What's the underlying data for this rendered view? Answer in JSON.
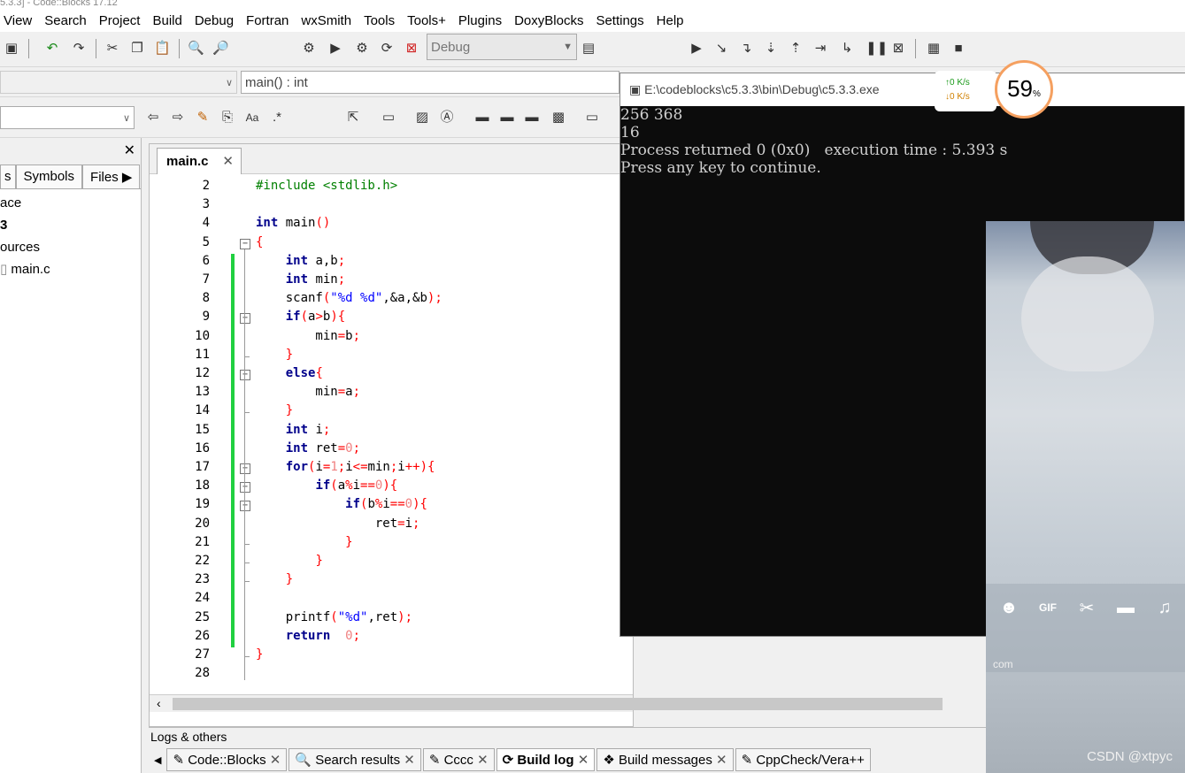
{
  "window": {
    "title_fragment": "5.3.3] - Code::Blocks 17.12"
  },
  "menu": [
    "View",
    "Search",
    "Project",
    "Build",
    "Debug",
    "Fortran",
    "wxSmith",
    "Tools",
    "Tools+",
    "Plugins",
    "DoxyBlocks",
    "Settings",
    "Help"
  ],
  "toolbar": {
    "build_target": "Debug",
    "function_combo": "main() : int"
  },
  "left_panel": {
    "close_glyph": "✕",
    "tabs": [
      "s",
      "Symbols",
      "Files"
    ],
    "tree": [
      "ace",
      "3",
      "ources",
      "main.c"
    ]
  },
  "editor": {
    "tab_label": "main.c",
    "tab_close": "✕",
    "lines": [
      {
        "n": "2",
        "text": "#include <stdlib.h>"
      },
      {
        "n": "3",
        "text": ""
      },
      {
        "n": "4",
        "text": "int main()"
      },
      {
        "n": "5",
        "text": "{"
      },
      {
        "n": "6",
        "text": "    int a,b;"
      },
      {
        "n": "7",
        "text": "    int min;"
      },
      {
        "n": "8",
        "text": "    scanf(\"%d %d\",&a,&b);"
      },
      {
        "n": "9",
        "text": "    if(a>b){"
      },
      {
        "n": "10",
        "text": "        min=b;"
      },
      {
        "n": "11",
        "text": "    }"
      },
      {
        "n": "12",
        "text": "    else{"
      },
      {
        "n": "13",
        "text": "        min=a;"
      },
      {
        "n": "14",
        "text": "    }"
      },
      {
        "n": "15",
        "text": "    int i;"
      },
      {
        "n": "16",
        "text": "    int ret=0;"
      },
      {
        "n": "17",
        "text": "    for(i=1;i<=min;i++){"
      },
      {
        "n": "18",
        "text": "        if(a%i==0){"
      },
      {
        "n": "19",
        "text": "            if(b%i==0){"
      },
      {
        "n": "20",
        "text": "                ret=i;"
      },
      {
        "n": "21",
        "text": "            }"
      },
      {
        "n": "22",
        "text": "        }"
      },
      {
        "n": "23",
        "text": "    }"
      },
      {
        "n": "24",
        "text": ""
      },
      {
        "n": "25",
        "text": "    printf(\"%d\",ret);"
      },
      {
        "n": "26",
        "text": "    return  0;"
      },
      {
        "n": "27",
        "text": "}"
      },
      {
        "n": "28",
        "text": ""
      }
    ]
  },
  "logs": {
    "label": "Logs & others",
    "tabs": [
      "Code::Blocks",
      "Search results",
      "Cccc",
      "Build log",
      "Build messages",
      "CppCheck/Vera++"
    ],
    "selected": "Build log"
  },
  "console": {
    "title": "E:\\codeblocks\\c5.3.3\\bin\\Debug\\c5.3.3.exe",
    "output": [
      "256 368",
      "16",
      "Process returned 0 (0x0)   execution time : 5.393 s",
      "Press any key to continue."
    ]
  },
  "net_widget": {
    "up": "↑0  K/s",
    "down": "↓0  K/s",
    "percent": "59",
    "percent_unit": "%"
  },
  "overlay": {
    "watermark": "CSDN @xtpyc",
    "site_fragment": "com"
  },
  "colors": {
    "keyword": "#00008b",
    "preprocessor": "#008000",
    "string": "#0000ff",
    "operator": "#ff0000",
    "number": "#f08080",
    "change_bar": "#20d040",
    "console_bg": "#0c0c0c"
  }
}
